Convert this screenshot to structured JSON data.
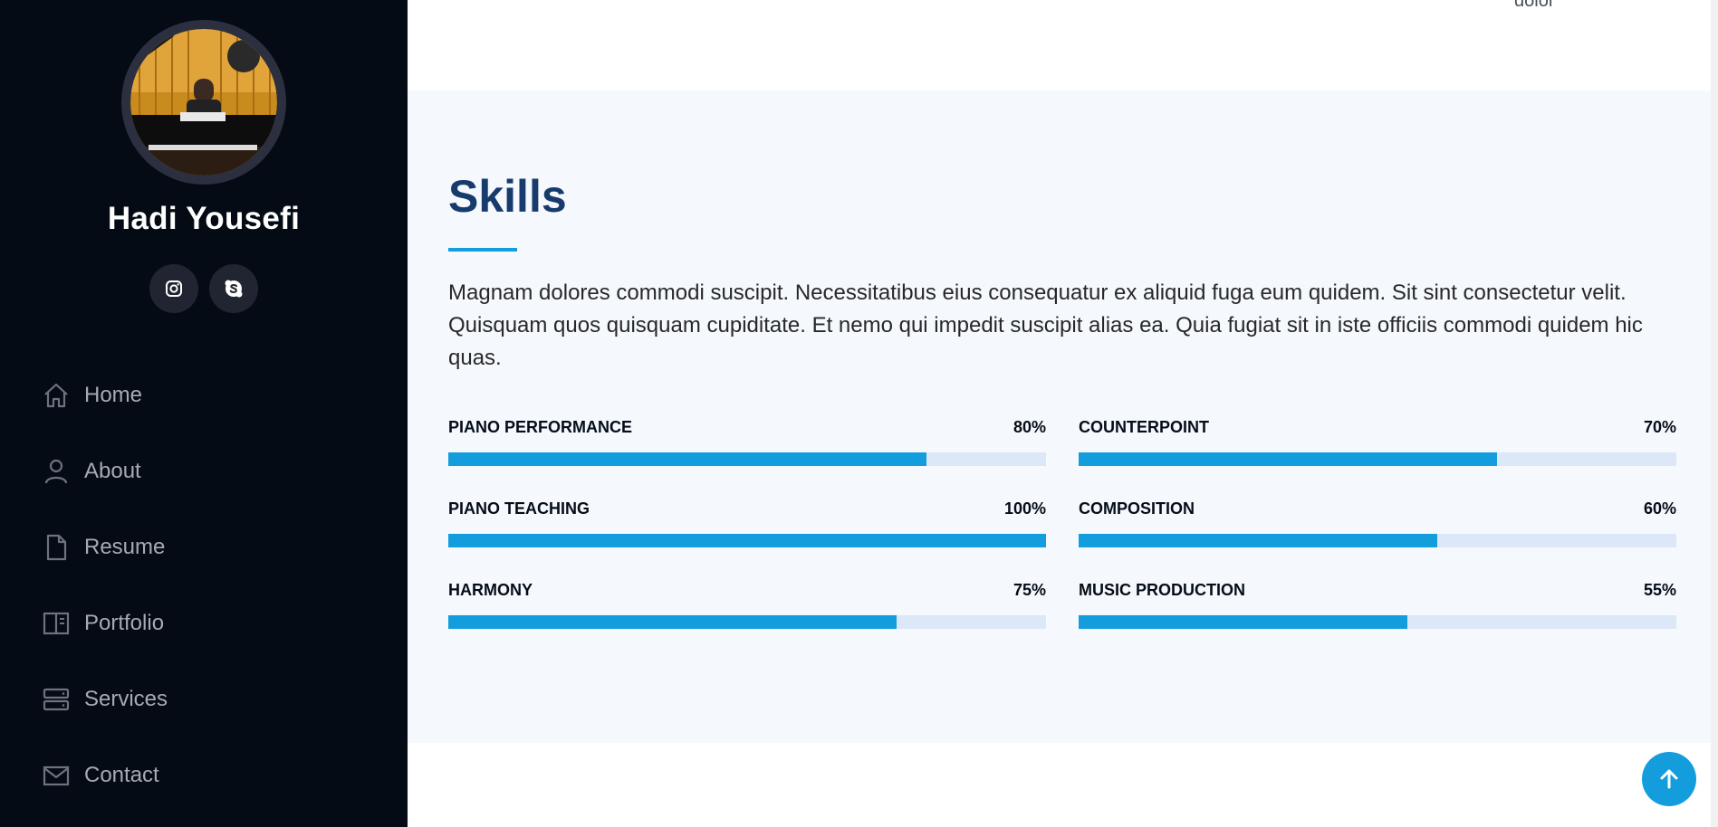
{
  "profile": {
    "name": "Hadi Yousefi",
    "avatar_icon": "avatar-photo-pianist"
  },
  "socials": [
    {
      "icon": "instagram-icon"
    },
    {
      "icon": "skype-icon"
    }
  ],
  "nav": {
    "items": [
      {
        "label": "Home",
        "icon": "home-icon"
      },
      {
        "label": "About",
        "icon": "person-icon"
      },
      {
        "label": "Resume",
        "icon": "file-icon"
      },
      {
        "label": "Portfolio",
        "icon": "portfolio-icon"
      },
      {
        "label": "Services",
        "icon": "server-icon"
      },
      {
        "label": "Contact",
        "icon": "envelope-icon"
      }
    ]
  },
  "top": {
    "cut_text": "dolor"
  },
  "skills": {
    "title": "Skills",
    "description": "Magnam dolores commodi suscipit. Necessitatibus eius consequatur ex aliquid fuga eum quidem. Sit sint consectetur velit. Quisquam quos quisquam cupiditate. Et nemo qui impedit suscipit alias ea. Quia fugiat sit in iste officiis commodi quidem hic quas.",
    "items": [
      {
        "name": "PIANO PERFORMANCE",
        "percent_label": "80%",
        "value": 80
      },
      {
        "name": "COUNTERPOINT",
        "percent_label": "70%",
        "value": 70
      },
      {
        "name": "PIANO TEACHING",
        "percent_label": "100%",
        "value": 100
      },
      {
        "name": "COMPOSITION",
        "percent_label": "60%",
        "value": 60
      },
      {
        "name": "HARMONY",
        "percent_label": "75%",
        "value": 75
      },
      {
        "name": "MUSIC PRODUCTION",
        "percent_label": "55%",
        "value": 55
      }
    ]
  },
  "colors": {
    "sidebar_bg": "#040b14",
    "accent": "#149ddd",
    "title": "#173b6c",
    "track": "#dce8f8",
    "section_bg": "#f5f8fd"
  },
  "back_to_top": {
    "icon": "arrow-up-icon"
  }
}
